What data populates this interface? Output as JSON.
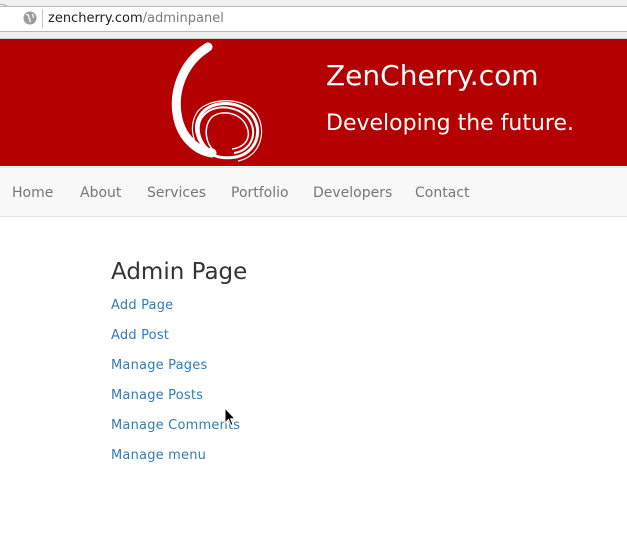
{
  "browser": {
    "url_domain": "zencherry.com",
    "url_path": "/adminpanel"
  },
  "header": {
    "site_title": "ZenCherry.com",
    "tagline": "Developing the future.",
    "logo_icon": "zen-cherry-logo-icon",
    "brand_color": "#b40000"
  },
  "nav": {
    "items": [
      {
        "label": "Home"
      },
      {
        "label": "About"
      },
      {
        "label": "Services"
      },
      {
        "label": "Portfolio"
      },
      {
        "label": "Developers"
      },
      {
        "label": "Contact"
      }
    ]
  },
  "main": {
    "heading": "Admin Page",
    "links": [
      {
        "label": "Add Page"
      },
      {
        "label": "Add Post"
      },
      {
        "label": "Manage Pages"
      },
      {
        "label": "Manage Posts"
      },
      {
        "label": "Manage Comments"
      },
      {
        "label": "Manage menu"
      }
    ],
    "link_color": "#337ab7"
  }
}
